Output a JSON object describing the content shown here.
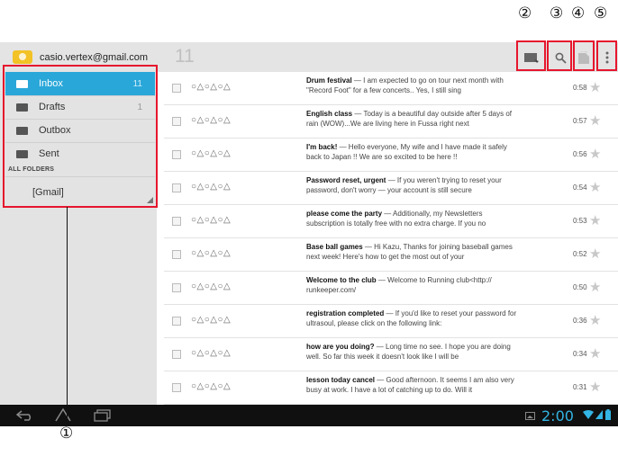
{
  "callouts": [
    "②",
    "③",
    "④",
    "⑤",
    "①"
  ],
  "header": {
    "account_email": "casio.vertex@gmail.com",
    "unread_count": "11"
  },
  "toolbar": {
    "compose_icon": "compose-icon",
    "search_icon": "search-icon",
    "labels_icon": "labels-icon",
    "menu_icon": "overflow-menu-icon"
  },
  "folders": [
    {
      "label": "Inbox",
      "count": "11",
      "icon": "inbox-icon",
      "selected": true
    },
    {
      "label": "Drafts",
      "count": "1",
      "icon": "drafts-icon"
    },
    {
      "label": "Outbox",
      "count": "",
      "icon": "outbox-icon"
    },
    {
      "label": "Sent",
      "count": "",
      "icon": "sent-icon"
    }
  ],
  "all_folders_label": "ALL FOLDERS",
  "gmail_folder": "[Gmail]",
  "messages": [
    {
      "sender": "○△○△○△",
      "subject": "Drum festival",
      "snippet": " — I am expected to go on tour next month with \"Record Foot\" for a few concerts.. Yes, I still sing",
      "time": "0:58"
    },
    {
      "sender": "○△○△○△",
      "subject": "English class",
      "snippet": " — Today is a beautiful day outside after 5 days of rain (WOW)...We are living here in Fussa right next",
      "time": "0:57"
    },
    {
      "sender": "○△○△○△",
      "subject": "I'm back!",
      "snippet": " — Hello everyone, My wife and I have made it safely back to Japan !! We are so excited to be here !!",
      "time": "0:56"
    },
    {
      "sender": "○△○△○△",
      "subject": "Password reset, urgent",
      "snippet": " — If you weren't trying to reset your password, don't worry — your account is still secure",
      "time": "0:54"
    },
    {
      "sender": "○△○△○△",
      "subject": "please come the party",
      "snippet": " — Additionally, my Newsletters subscription is totally free with no extra charge. If you no",
      "time": "0:53"
    },
    {
      "sender": "○△○△○△",
      "subject": "Base ball games",
      "snippet": " — Hi Kazu, Thanks for joining baseball games next week! Here's how to get the most out of your",
      "time": "0:52"
    },
    {
      "sender": "○△○△○△",
      "subject": "Welcome to the club",
      "snippet": " — Welcome to Running club<http:// runkeeper.com/",
      "time": "0:50"
    },
    {
      "sender": "○△○△○△",
      "subject": "registration completed",
      "snippet": " — If you'd like to reset your password for ultrasoul, please click on the following link:",
      "time": "0:36"
    },
    {
      "sender": "○△○△○△",
      "subject": "how are you doing?",
      "snippet": " — Long time no see. I hope you are doing well. So far this week it doesn't look like I will be",
      "time": "0:34"
    },
    {
      "sender": "○△○△○△",
      "subject": "lesson today cancel",
      "snippet": " — Good afternoon. It seems I am also very busy at work. I have a lot of catching up to do. Will it",
      "time": "0:31"
    }
  ],
  "statusbar": {
    "clock": "2:00",
    "back_icon": "back-icon",
    "home_icon": "home-icon",
    "recents_icon": "recent-apps-icon"
  },
  "colors": {
    "accent": "#2aa7d9",
    "callout_box": "#e6162d",
    "clock": "#33b5e5"
  }
}
